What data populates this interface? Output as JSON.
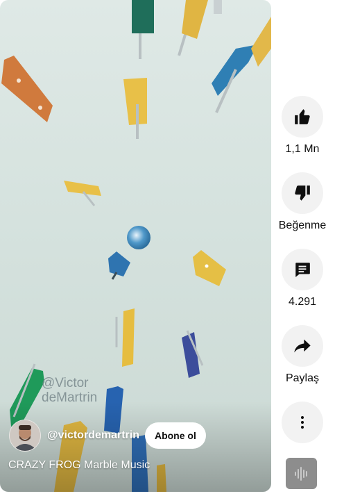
{
  "video": {
    "watermark": "@Victor\ndeMartrin",
    "channel_handle": "@victordemartrin",
    "subscribe_label": "Abone ol",
    "title": "CRAZY FROG Marble Music"
  },
  "actions": {
    "like": {
      "icon": "thumbs-up-icon",
      "label": "1,1 Mn"
    },
    "dislike": {
      "icon": "thumbs-down-icon",
      "label": "Beğenme"
    },
    "comments": {
      "icon": "comment-icon",
      "label": "4.291"
    },
    "share": {
      "icon": "share-icon",
      "label": "Paylaş"
    },
    "more": {
      "icon": "more-vertical-icon"
    },
    "sound": {
      "icon": "audio-waveform-icon"
    }
  },
  "colors": {
    "action_circle": "#f2f2f2",
    "text_primary": "#0f0f0f",
    "subscribe_bg": "#ffffff"
  }
}
